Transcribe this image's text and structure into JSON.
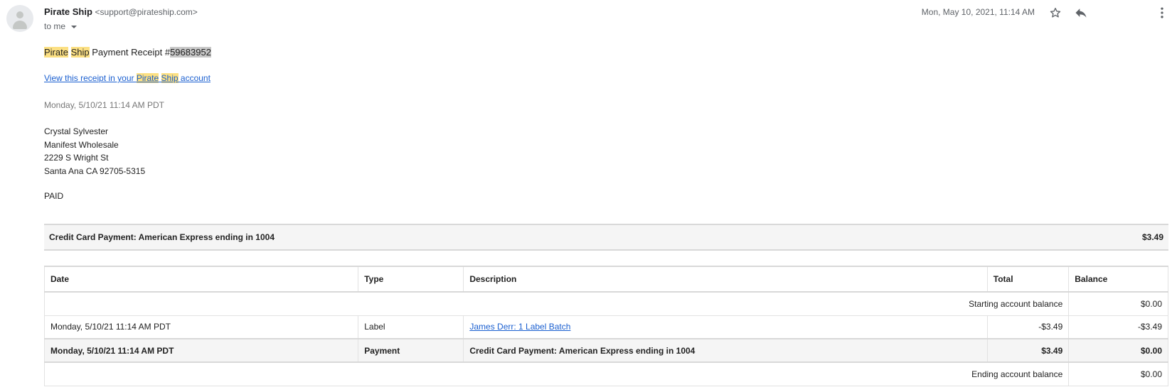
{
  "email": {
    "sender_name": "Pirate Ship",
    "sender_email": "<support@pirateship.com>",
    "to": "to me",
    "date": "Mon, May 10, 2021, 11:14 AM",
    "icons": [
      "star-icon",
      "reply-icon",
      "more-vert-icon"
    ]
  },
  "body": {
    "title_word1": "Pirate",
    "title_word2": "Ship",
    "title_mid": " Payment Receipt #",
    "receipt_number": "59683952",
    "link_prefix": "View this receipt in your ",
    "link_word1": "Pirate",
    "link_word2": "Ship",
    "link_suffix": " account",
    "timestamp": "Monday, 5/10/21 11:14 AM PDT",
    "address": {
      "name": "Crystal Sylvester",
      "company": "Manifest Wholesale",
      "street": "2229 S Wright St",
      "city": "Santa Ana CA 92705-5315"
    },
    "status": "PAID",
    "payment_summary": {
      "label": "Credit Card Payment: American Express ending in 1004",
      "amount": "$3.49"
    }
  },
  "table": {
    "headers": [
      "Date",
      "Type",
      "Description",
      "Total",
      "Balance"
    ],
    "starting": {
      "label": "Starting account balance",
      "balance": "$0.00"
    },
    "rows": [
      {
        "date": "Monday, 5/10/21 11:14 AM PDT",
        "type": "Label",
        "description": "James Derr: 1 Label Batch",
        "total": "-$3.49",
        "balance": "-$3.49"
      },
      {
        "date": "Monday, 5/10/21 11:14 AM PDT",
        "type": "Payment",
        "description": "Credit Card Payment: American Express ending in 1004",
        "total": "$3.49",
        "balance": "$0.00"
      }
    ],
    "ending": {
      "label": "Ending account balance",
      "balance": "$0.00"
    }
  }
}
